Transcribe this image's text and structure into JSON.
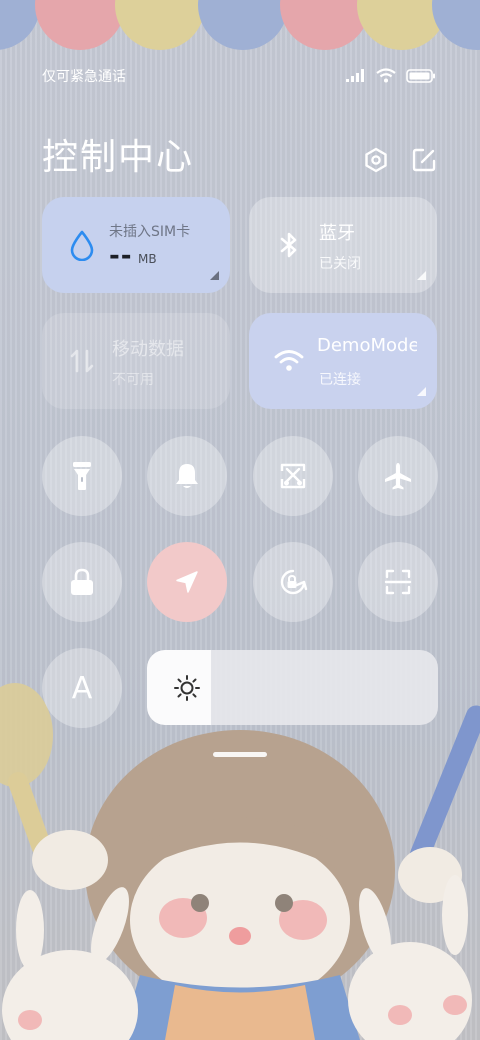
{
  "status_bar": {
    "carrier_text": "仅可紧急通话",
    "icons": [
      "signal-icon",
      "wifi-icon",
      "battery-icon"
    ]
  },
  "header": {
    "title": "控制中心",
    "icons": [
      "settings-icon",
      "edit-icon"
    ]
  },
  "tiles": {
    "sim": {
      "label": "未插入SIM卡",
      "value": "--",
      "unit": "MB",
      "icon": "water-drop-icon",
      "color": "#c6d1ee"
    },
    "bluetooth": {
      "label": "蓝牙",
      "status": "已关闭",
      "icon": "bluetooth-icon"
    },
    "mobile_data": {
      "label": "移动数据",
      "status": "不可用",
      "icon": "data-arrows-icon"
    },
    "wifi": {
      "label": "DemoMode",
      "status": "已连接",
      "icon": "wifi-icon",
      "color": "#c9d2ee"
    }
  },
  "toggles": [
    {
      "icon": "flashlight-icon"
    },
    {
      "icon": "bell-icon"
    },
    {
      "icon": "screenshot-icon"
    },
    {
      "icon": "airplane-icon"
    },
    {
      "icon": "lock-icon"
    },
    {
      "icon": "location-icon",
      "active": true,
      "color": "#f2c9c9"
    },
    {
      "icon": "auto-rotate-icon"
    },
    {
      "icon": "scanner-icon"
    },
    {
      "icon": "font-size-icon",
      "label": "A"
    }
  ],
  "brightness": {
    "icon": "sun-icon",
    "level": 0.22
  },
  "colors": {
    "accent_blue": "#2d8cf0"
  }
}
